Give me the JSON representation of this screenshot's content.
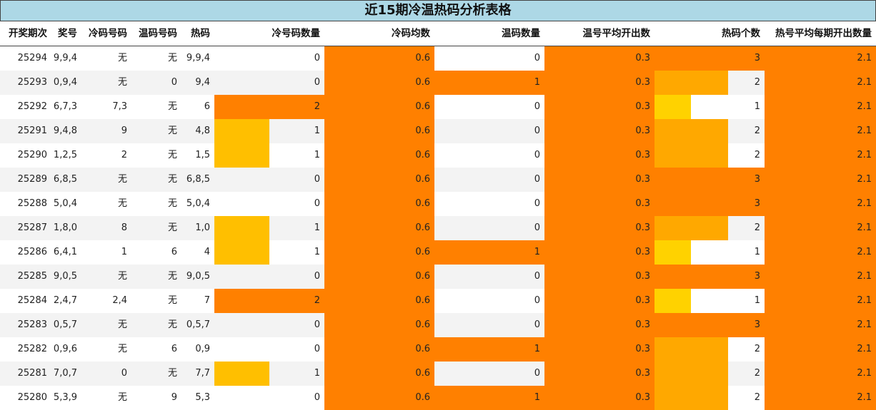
{
  "title": "近15期冷温热码分析表格",
  "headers": [
    "开奖期次",
    "奖号",
    "冷码号码",
    "温码号码",
    "热码",
    "冷号码数量",
    "冷码均数",
    "温码数量",
    "温号平均开出数",
    "热码个数",
    "热号平均每期开出数量"
  ],
  "colors": {
    "full": "#ff8000",
    "hot_1": "#ffd200",
    "hot_2": "#ffa800",
    "cold_1": "#ffbf00",
    "title_bg": "#add8e6"
  },
  "rows": [
    {
      "period": "25294",
      "numbers": "9,9,4",
      "cold": "无",
      "warm": "无",
      "hot": "9,9,4",
      "cold_count": "0",
      "cold_avg": "0.6",
      "warm_count": "0",
      "warm_avg": "0.3",
      "hot_count": "3",
      "hot_avg": "2.1"
    },
    {
      "period": "25293",
      "numbers": "0,9,4",
      "cold": "无",
      "warm": "0",
      "hot": "9,4",
      "cold_count": "0",
      "cold_avg": "0.6",
      "warm_count": "1",
      "warm_avg": "0.3",
      "hot_count": "2",
      "hot_avg": "2.1"
    },
    {
      "period": "25292",
      "numbers": "6,7,3",
      "cold": "7,3",
      "warm": "无",
      "hot": "6",
      "cold_count": "2",
      "cold_avg": "0.6",
      "warm_count": "0",
      "warm_avg": "0.3",
      "hot_count": "1",
      "hot_avg": "2.1"
    },
    {
      "period": "25291",
      "numbers": "9,4,8",
      "cold": "9",
      "warm": "无",
      "hot": "4,8",
      "cold_count": "1",
      "cold_avg": "0.6",
      "warm_count": "0",
      "warm_avg": "0.3",
      "hot_count": "2",
      "hot_avg": "2.1"
    },
    {
      "period": "25290",
      "numbers": "1,2,5",
      "cold": "2",
      "warm": "无",
      "hot": "1,5",
      "cold_count": "1",
      "cold_avg": "0.6",
      "warm_count": "0",
      "warm_avg": "0.3",
      "hot_count": "2",
      "hot_avg": "2.1"
    },
    {
      "period": "25289",
      "numbers": "6,8,5",
      "cold": "无",
      "warm": "无",
      "hot": "6,8,5",
      "cold_count": "0",
      "cold_avg": "0.6",
      "warm_count": "0",
      "warm_avg": "0.3",
      "hot_count": "3",
      "hot_avg": "2.1"
    },
    {
      "period": "25288",
      "numbers": "5,0,4",
      "cold": "无",
      "warm": "无",
      "hot": "5,0,4",
      "cold_count": "0",
      "cold_avg": "0.6",
      "warm_count": "0",
      "warm_avg": "0.3",
      "hot_count": "3",
      "hot_avg": "2.1"
    },
    {
      "period": "25287",
      "numbers": "1,8,0",
      "cold": "8",
      "warm": "无",
      "hot": "1,0",
      "cold_count": "1",
      "cold_avg": "0.6",
      "warm_count": "0",
      "warm_avg": "0.3",
      "hot_count": "2",
      "hot_avg": "2.1"
    },
    {
      "period": "25286",
      "numbers": "6,4,1",
      "cold": "1",
      "warm": "6",
      "hot": "4",
      "cold_count": "1",
      "cold_avg": "0.6",
      "warm_count": "1",
      "warm_avg": "0.3",
      "hot_count": "1",
      "hot_avg": "2.1"
    },
    {
      "period": "25285",
      "numbers": "9,0,5",
      "cold": "无",
      "warm": "无",
      "hot": "9,0,5",
      "cold_count": "0",
      "cold_avg": "0.6",
      "warm_count": "0",
      "warm_avg": "0.3",
      "hot_count": "3",
      "hot_avg": "2.1"
    },
    {
      "period": "25284",
      "numbers": "2,4,7",
      "cold": "2,4",
      "warm": "无",
      "hot": "7",
      "cold_count": "2",
      "cold_avg": "0.6",
      "warm_count": "0",
      "warm_avg": "0.3",
      "hot_count": "1",
      "hot_avg": "2.1"
    },
    {
      "period": "25283",
      "numbers": "0,5,7",
      "cold": "无",
      "warm": "无",
      "hot": "0,5,7",
      "cold_count": "0",
      "cold_avg": "0.6",
      "warm_count": "0",
      "warm_avg": "0.3",
      "hot_count": "3",
      "hot_avg": "2.1"
    },
    {
      "period": "25282",
      "numbers": "0,9,6",
      "cold": "无",
      "warm": "6",
      "hot": "0,9",
      "cold_count": "0",
      "cold_avg": "0.6",
      "warm_count": "1",
      "warm_avg": "0.3",
      "hot_count": "2",
      "hot_avg": "2.1"
    },
    {
      "period": "25281",
      "numbers": "7,0,7",
      "cold": "0",
      "warm": "无",
      "hot": "7,7",
      "cold_count": "1",
      "cold_avg": "0.6",
      "warm_count": "0",
      "warm_avg": "0.3",
      "hot_count": "2",
      "hot_avg": "2.1"
    },
    {
      "period": "25280",
      "numbers": "5,3,9",
      "cold": "无",
      "warm": "9",
      "hot": "5,3",
      "cold_count": "0",
      "cold_avg": "0.6",
      "warm_count": "1",
      "warm_avg": "0.3",
      "hot_count": "2",
      "hot_avg": "2.1"
    }
  ]
}
